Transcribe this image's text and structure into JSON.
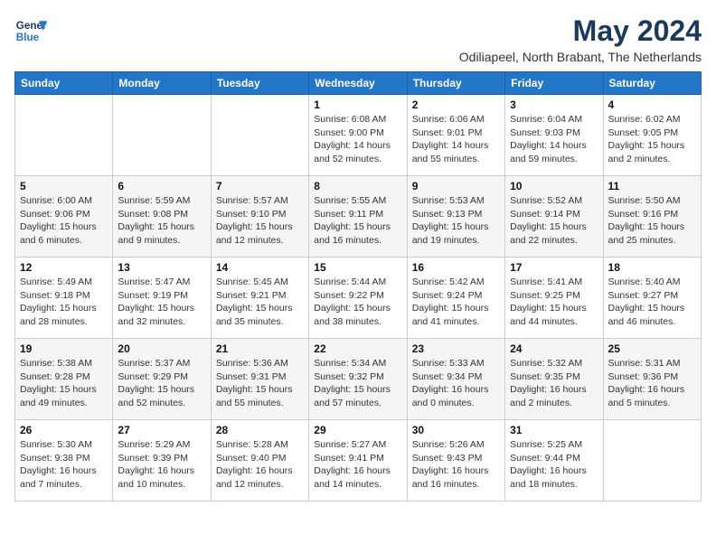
{
  "logo": {
    "line1": "General",
    "line2": "Blue"
  },
  "title": "May 2024",
  "subtitle": "Odiliapeel, North Brabant, The Netherlands",
  "days_header": [
    "Sunday",
    "Monday",
    "Tuesday",
    "Wednesday",
    "Thursday",
    "Friday",
    "Saturday"
  ],
  "weeks": [
    [
      {
        "day": "",
        "info": ""
      },
      {
        "day": "",
        "info": ""
      },
      {
        "day": "",
        "info": ""
      },
      {
        "day": "1",
        "info": "Sunrise: 6:08 AM\nSunset: 9:00 PM\nDaylight: 14 hours\nand 52 minutes."
      },
      {
        "day": "2",
        "info": "Sunrise: 6:06 AM\nSunset: 9:01 PM\nDaylight: 14 hours\nand 55 minutes."
      },
      {
        "day": "3",
        "info": "Sunrise: 6:04 AM\nSunset: 9:03 PM\nDaylight: 14 hours\nand 59 minutes."
      },
      {
        "day": "4",
        "info": "Sunrise: 6:02 AM\nSunset: 9:05 PM\nDaylight: 15 hours\nand 2 minutes."
      }
    ],
    [
      {
        "day": "5",
        "info": "Sunrise: 6:00 AM\nSunset: 9:06 PM\nDaylight: 15 hours\nand 6 minutes."
      },
      {
        "day": "6",
        "info": "Sunrise: 5:59 AM\nSunset: 9:08 PM\nDaylight: 15 hours\nand 9 minutes."
      },
      {
        "day": "7",
        "info": "Sunrise: 5:57 AM\nSunset: 9:10 PM\nDaylight: 15 hours\nand 12 minutes."
      },
      {
        "day": "8",
        "info": "Sunrise: 5:55 AM\nSunset: 9:11 PM\nDaylight: 15 hours\nand 16 minutes."
      },
      {
        "day": "9",
        "info": "Sunrise: 5:53 AM\nSunset: 9:13 PM\nDaylight: 15 hours\nand 19 minutes."
      },
      {
        "day": "10",
        "info": "Sunrise: 5:52 AM\nSunset: 9:14 PM\nDaylight: 15 hours\nand 22 minutes."
      },
      {
        "day": "11",
        "info": "Sunrise: 5:50 AM\nSunset: 9:16 PM\nDaylight: 15 hours\nand 25 minutes."
      }
    ],
    [
      {
        "day": "12",
        "info": "Sunrise: 5:49 AM\nSunset: 9:18 PM\nDaylight: 15 hours\nand 28 minutes."
      },
      {
        "day": "13",
        "info": "Sunrise: 5:47 AM\nSunset: 9:19 PM\nDaylight: 15 hours\nand 32 minutes."
      },
      {
        "day": "14",
        "info": "Sunrise: 5:45 AM\nSunset: 9:21 PM\nDaylight: 15 hours\nand 35 minutes."
      },
      {
        "day": "15",
        "info": "Sunrise: 5:44 AM\nSunset: 9:22 PM\nDaylight: 15 hours\nand 38 minutes."
      },
      {
        "day": "16",
        "info": "Sunrise: 5:42 AM\nSunset: 9:24 PM\nDaylight: 15 hours\nand 41 minutes."
      },
      {
        "day": "17",
        "info": "Sunrise: 5:41 AM\nSunset: 9:25 PM\nDaylight: 15 hours\nand 44 minutes."
      },
      {
        "day": "18",
        "info": "Sunrise: 5:40 AM\nSunset: 9:27 PM\nDaylight: 15 hours\nand 46 minutes."
      }
    ],
    [
      {
        "day": "19",
        "info": "Sunrise: 5:38 AM\nSunset: 9:28 PM\nDaylight: 15 hours\nand 49 minutes."
      },
      {
        "day": "20",
        "info": "Sunrise: 5:37 AM\nSunset: 9:29 PM\nDaylight: 15 hours\nand 52 minutes."
      },
      {
        "day": "21",
        "info": "Sunrise: 5:36 AM\nSunset: 9:31 PM\nDaylight: 15 hours\nand 55 minutes."
      },
      {
        "day": "22",
        "info": "Sunrise: 5:34 AM\nSunset: 9:32 PM\nDaylight: 15 hours\nand 57 minutes."
      },
      {
        "day": "23",
        "info": "Sunrise: 5:33 AM\nSunset: 9:34 PM\nDaylight: 16 hours\nand 0 minutes."
      },
      {
        "day": "24",
        "info": "Sunrise: 5:32 AM\nSunset: 9:35 PM\nDaylight: 16 hours\nand 2 minutes."
      },
      {
        "day": "25",
        "info": "Sunrise: 5:31 AM\nSunset: 9:36 PM\nDaylight: 16 hours\nand 5 minutes."
      }
    ],
    [
      {
        "day": "26",
        "info": "Sunrise: 5:30 AM\nSunset: 9:38 PM\nDaylight: 16 hours\nand 7 minutes."
      },
      {
        "day": "27",
        "info": "Sunrise: 5:29 AM\nSunset: 9:39 PM\nDaylight: 16 hours\nand 10 minutes."
      },
      {
        "day": "28",
        "info": "Sunrise: 5:28 AM\nSunset: 9:40 PM\nDaylight: 16 hours\nand 12 minutes."
      },
      {
        "day": "29",
        "info": "Sunrise: 5:27 AM\nSunset: 9:41 PM\nDaylight: 16 hours\nand 14 minutes."
      },
      {
        "day": "30",
        "info": "Sunrise: 5:26 AM\nSunset: 9:43 PM\nDaylight: 16 hours\nand 16 minutes."
      },
      {
        "day": "31",
        "info": "Sunrise: 5:25 AM\nSunset: 9:44 PM\nDaylight: 16 hours\nand 18 minutes."
      },
      {
        "day": "",
        "info": ""
      }
    ]
  ]
}
